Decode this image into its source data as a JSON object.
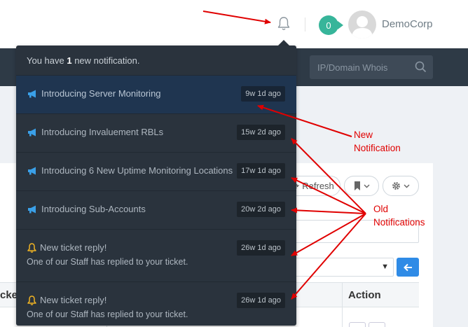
{
  "header": {
    "cart_count": "0",
    "username": "DemoCorp"
  },
  "navbar": {
    "whois_placeholder": "IP/Domain Whois"
  },
  "toolbar": {
    "refresh_label": "Refresh"
  },
  "table": {
    "col_left_fragment": "cket",
    "col_action": "Action"
  },
  "notifications": {
    "header_prefix": "You have ",
    "header_count": "1",
    "header_suffix": " new notification.",
    "items": [
      {
        "icon": "megaphone-icon",
        "title": "Introducing Server Monitoring",
        "time": "9w 1d ago",
        "body": "",
        "is_new": true
      },
      {
        "icon": "megaphone-icon",
        "title": "Introducing Invaluement RBLs",
        "time": "15w 2d ago",
        "body": "",
        "is_new": false
      },
      {
        "icon": "megaphone-icon",
        "title": "Introducing 6 New Uptime Monitoring Locations",
        "time": "17w 1d ago",
        "body": "",
        "is_new": false
      },
      {
        "icon": "megaphone-icon",
        "title": "Introducing Sub-Accounts",
        "time": "20w 2d ago",
        "body": "",
        "is_new": false
      },
      {
        "icon": "bell-icon",
        "title": "New ticket reply!",
        "time": "26w 1d ago",
        "body": "One of our Staff has replied to your ticket.",
        "is_new": false
      },
      {
        "icon": "bell-icon",
        "title": "New ticket reply!",
        "time": "26w 1d ago",
        "body": "One of our Staff has replied to your ticket.",
        "is_new": false
      }
    ]
  },
  "annotations": {
    "new_label_line1": "New",
    "new_label_line2": "Notification",
    "old_label_line1": "Old",
    "old_label_line2": "Notifications",
    "color": "#e00000"
  },
  "colors": {
    "navbar": "#2e3a46",
    "dropdown": "#2a333d",
    "active_item": "#1f3550",
    "cart_badge": "#37b59a",
    "accent_blue": "#2f8be6",
    "icon_blue": "#3aa0e8",
    "icon_yellow": "#f0b323"
  }
}
